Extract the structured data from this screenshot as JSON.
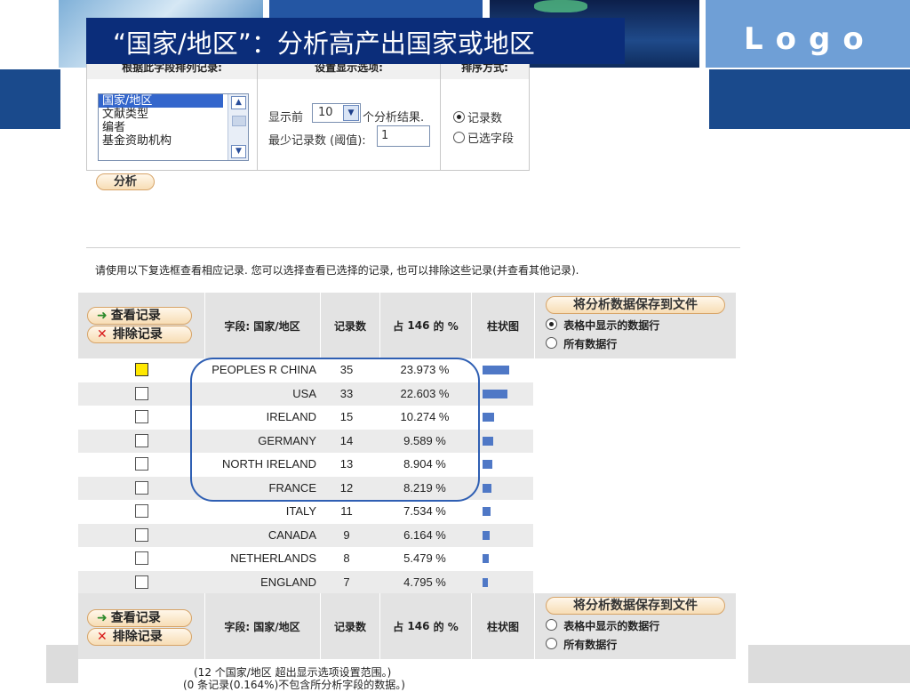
{
  "slide": {
    "title": "“国家/地区”：分析高产出国家或地区",
    "logo": "Logo"
  },
  "settings": {
    "col_field": "根据此字段排列记录:",
    "col_display": "设置显示选项:",
    "col_sort": "排序方式:",
    "field_list": [
      "国家/地区",
      "文献类型",
      "编者",
      "基金资助机构"
    ],
    "field_selected": "国家/地区",
    "show_prefix": "显示前",
    "show_value": "10",
    "show_suffix": "个分析结果.",
    "threshold_label": "最少记录数 (阈值):",
    "threshold_value": "1",
    "sort_options": [
      "记录数",
      "已选字段"
    ],
    "sort_selected": "记录数",
    "analyze_button": "分析"
  },
  "instructions": "请使用以下复选框查看相应记录. 您可以选择查看已选择的记录, 也可以排除这些记录(并查看其他记录).",
  "table": {
    "view_records": "查看记录",
    "exclude_records": "排除记录",
    "field_header": "字段: 国家/地区",
    "count_header": "记录数",
    "percent_header_pre": "占",
    "percent_header_num": "146",
    "percent_header_post": "的 %",
    "chart_header": "柱状图",
    "save_button": "将分析数据保存到文件",
    "save_opt_rows": "表格中显示的数据行",
    "save_opt_all": "所有数据行",
    "top_save_selected": "表格中显示的数据行",
    "bottom_save_selected": "none",
    "rows": [
      {
        "country": "PEOPLES R CHINA",
        "count": "35",
        "percent": "23.973 %",
        "share": 23.973,
        "checked": true
      },
      {
        "country": "USA",
        "count": "33",
        "percent": "22.603 %",
        "share": 22.603,
        "checked": false
      },
      {
        "country": "IRELAND",
        "count": "15",
        "percent": "10.274 %",
        "share": 10.274,
        "checked": false
      },
      {
        "country": "GERMANY",
        "count": "14",
        "percent": "9.589 %",
        "share": 9.589,
        "checked": false
      },
      {
        "country": "NORTH IRELAND",
        "count": "13",
        "percent": "8.904 %",
        "share": 8.904,
        "checked": false
      },
      {
        "country": "FRANCE",
        "count": "12",
        "percent": "8.219 %",
        "share": 8.219,
        "checked": false
      },
      {
        "country": "ITALY",
        "count": "11",
        "percent": "7.534 %",
        "share": 7.534,
        "checked": false
      },
      {
        "country": "CANADA",
        "count": "9",
        "percent": "6.164 %",
        "share": 6.164,
        "checked": false
      },
      {
        "country": "NETHERLANDS",
        "count": "8",
        "percent": "5.479 %",
        "share": 5.479,
        "checked": false
      },
      {
        "country": "ENGLAND",
        "count": "7",
        "percent": "4.795 %",
        "share": 4.795,
        "checked": false
      }
    ]
  },
  "footnotes": {
    "line1": "(12 个国家/地区 超出显示选项设置范围。)",
    "line2": "(0 条记录(0.164%)不包含所分析字段的数据。)"
  },
  "colors": {
    "title_bg": "#0b2d7a",
    "band": "#1a4a8c",
    "bar": "#4f78c6",
    "highlight_outline": "#2f5fb3",
    "checkbox_highlight": "#ffe800"
  }
}
